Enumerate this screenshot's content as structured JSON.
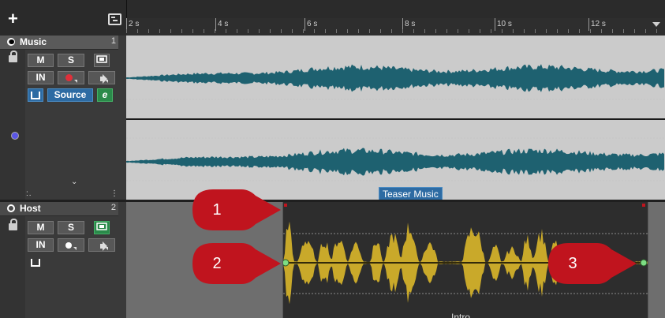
{
  "toolbar": {
    "add_icon": "plus-icon",
    "collapse_icon": "track-layout-icon"
  },
  "ruler": {
    "labels": [
      "2 s",
      "4 s",
      "6 s",
      "8 s",
      "10 s",
      "12 s"
    ]
  },
  "tracks": [
    {
      "name": "Music",
      "number": "1",
      "buttons": {
        "mute": "M",
        "solo": "S",
        "input": "IN",
        "source": "Source",
        "edit": "e"
      },
      "clip_label": "Teaser Music",
      "waveform_color": "#1e6170"
    },
    {
      "name": "Host",
      "number": "2",
      "buttons": {
        "mute": "M",
        "solo": "S",
        "input": "IN"
      },
      "clip_label": "Intro",
      "waveform_color": "#c9a92a"
    }
  ],
  "callouts": [
    "1",
    "2",
    "3"
  ],
  "colors": {
    "callout": "#c0141e",
    "envelope_point": "#7dde84",
    "selected_label": "#2d6ba3"
  }
}
